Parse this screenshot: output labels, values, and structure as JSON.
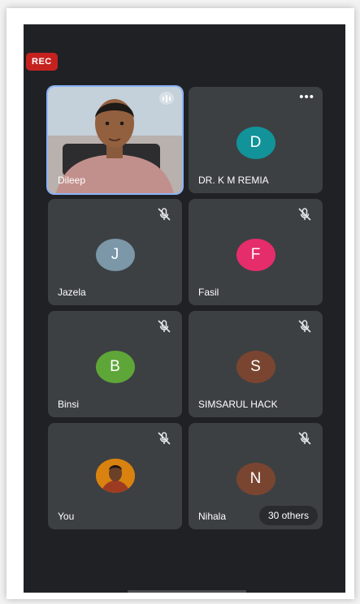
{
  "recording": {
    "label": "REC",
    "color": "#c5221f"
  },
  "participants": [
    {
      "name": "Dileep",
      "type": "video",
      "active": true,
      "indicator": "speaking-icon"
    },
    {
      "name": "DR. K M REMIA",
      "initial": "D",
      "color": "#12939a",
      "indicator": "more-options-icon"
    },
    {
      "name": "Jazela",
      "initial": "J",
      "color": "#7b97a8",
      "indicator": "mic-off-icon"
    },
    {
      "name": "Fasil",
      "initial": "F",
      "color": "#e52d6b",
      "indicator": "mic-off-icon"
    },
    {
      "name": "Binsi",
      "initial": "B",
      "color": "#5fa638",
      "indicator": "mic-off-icon"
    },
    {
      "name": "SIMSARUL HACK",
      "initial": "S",
      "color": "#7a4530",
      "indicator": "mic-off-icon"
    },
    {
      "name": "You",
      "type": "photo",
      "indicator": "mic-off-icon"
    },
    {
      "name": "Nihala",
      "initial": "N",
      "color": "#7a4530",
      "indicator": "mic-off-icon"
    }
  ],
  "others_chip": {
    "label": "30 others"
  }
}
